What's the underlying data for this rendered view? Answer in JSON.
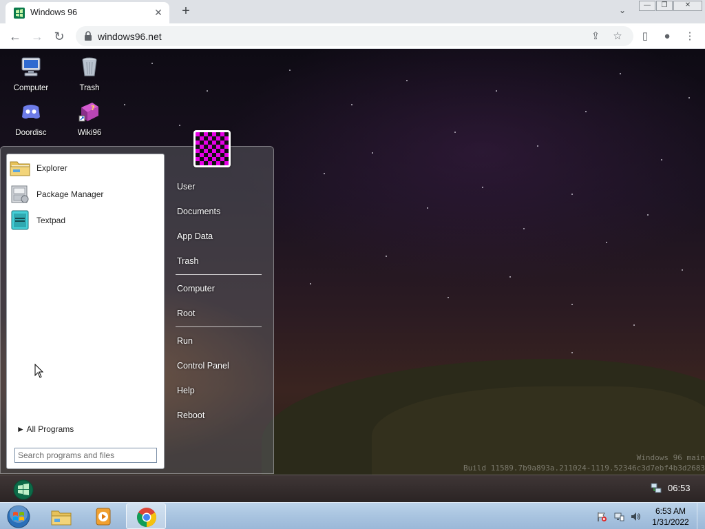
{
  "browser": {
    "tab": {
      "title": "Windows 96",
      "close_glyph": "✕",
      "favicon": "windows96-favicon"
    },
    "new_tab_glyph": "+",
    "tab_search_glyph": "⌄",
    "window_controls": {
      "minimize": "—",
      "restore": "❐",
      "close": "✕"
    },
    "nav": {
      "back": "←",
      "forward": "→",
      "reload": "↻"
    },
    "address": {
      "url": "windows96.net",
      "lock": "lock-icon"
    },
    "omnibox_icons": {
      "share": "⇪",
      "bookmark": "☆"
    },
    "toolbar_icons": {
      "side_panel": "▯",
      "profile": "●",
      "menu": "⋮"
    }
  },
  "desktop": {
    "icons": [
      {
        "label": "Computer",
        "icon": "computer-icon"
      },
      {
        "label": "Trash",
        "icon": "trash-icon"
      },
      {
        "label": "Doordisc",
        "icon": "doordisc-icon"
      },
      {
        "label": "Wiki96",
        "icon": "wiki96-icon"
      }
    ],
    "build_line1": "Windows 96 main",
    "build_line2": "Build 11589.7b9a893a.211024-1119.52346c3d7ebf4b3d2683"
  },
  "start_menu": {
    "programs": [
      {
        "label": "Explorer",
        "icon": "folder-icon"
      },
      {
        "label": "Package Manager",
        "icon": "package-manager-icon"
      },
      {
        "label": "Textpad",
        "icon": "textpad-icon"
      }
    ],
    "all_programs": "► All Programs",
    "search_placeholder": "Search programs and files",
    "places": [
      {
        "label": "User"
      },
      {
        "label": "Documents"
      },
      {
        "label": "App Data"
      },
      {
        "label": "Trash"
      },
      {
        "label": "Computer"
      },
      {
        "label": "Root"
      },
      {
        "label": "Run"
      },
      {
        "label": "Control Panel"
      },
      {
        "label": "Help"
      },
      {
        "label": "Reboot"
      }
    ]
  },
  "w96_taskbar": {
    "clock": "06:53"
  },
  "host_taskbar": {
    "pinned": [
      "file-explorer-icon",
      "media-player-icon",
      "chrome-icon"
    ],
    "time": "6:53 AM",
    "date": "1/31/2022"
  },
  "colors": {
    "avatar_magenta": "#e600e6",
    "taskbar_blue": "#a9c4e0"
  }
}
